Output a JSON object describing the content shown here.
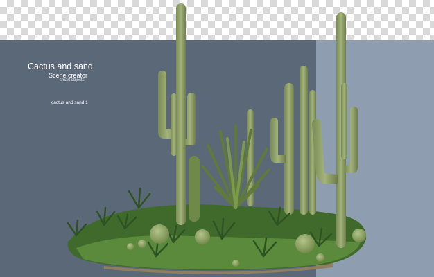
{
  "header": {
    "title": "Cactus and sand",
    "subtitle": "Scene creator",
    "tagline": "smart objects"
  },
  "labels": {
    "item": "cactus and sand 1"
  },
  "colors": {
    "background_dark": "#5a6878",
    "background_light": "#8e9eb0",
    "checker": "#d9d9d9",
    "cactus": "#93a46a",
    "grass": "#4f7a36"
  }
}
